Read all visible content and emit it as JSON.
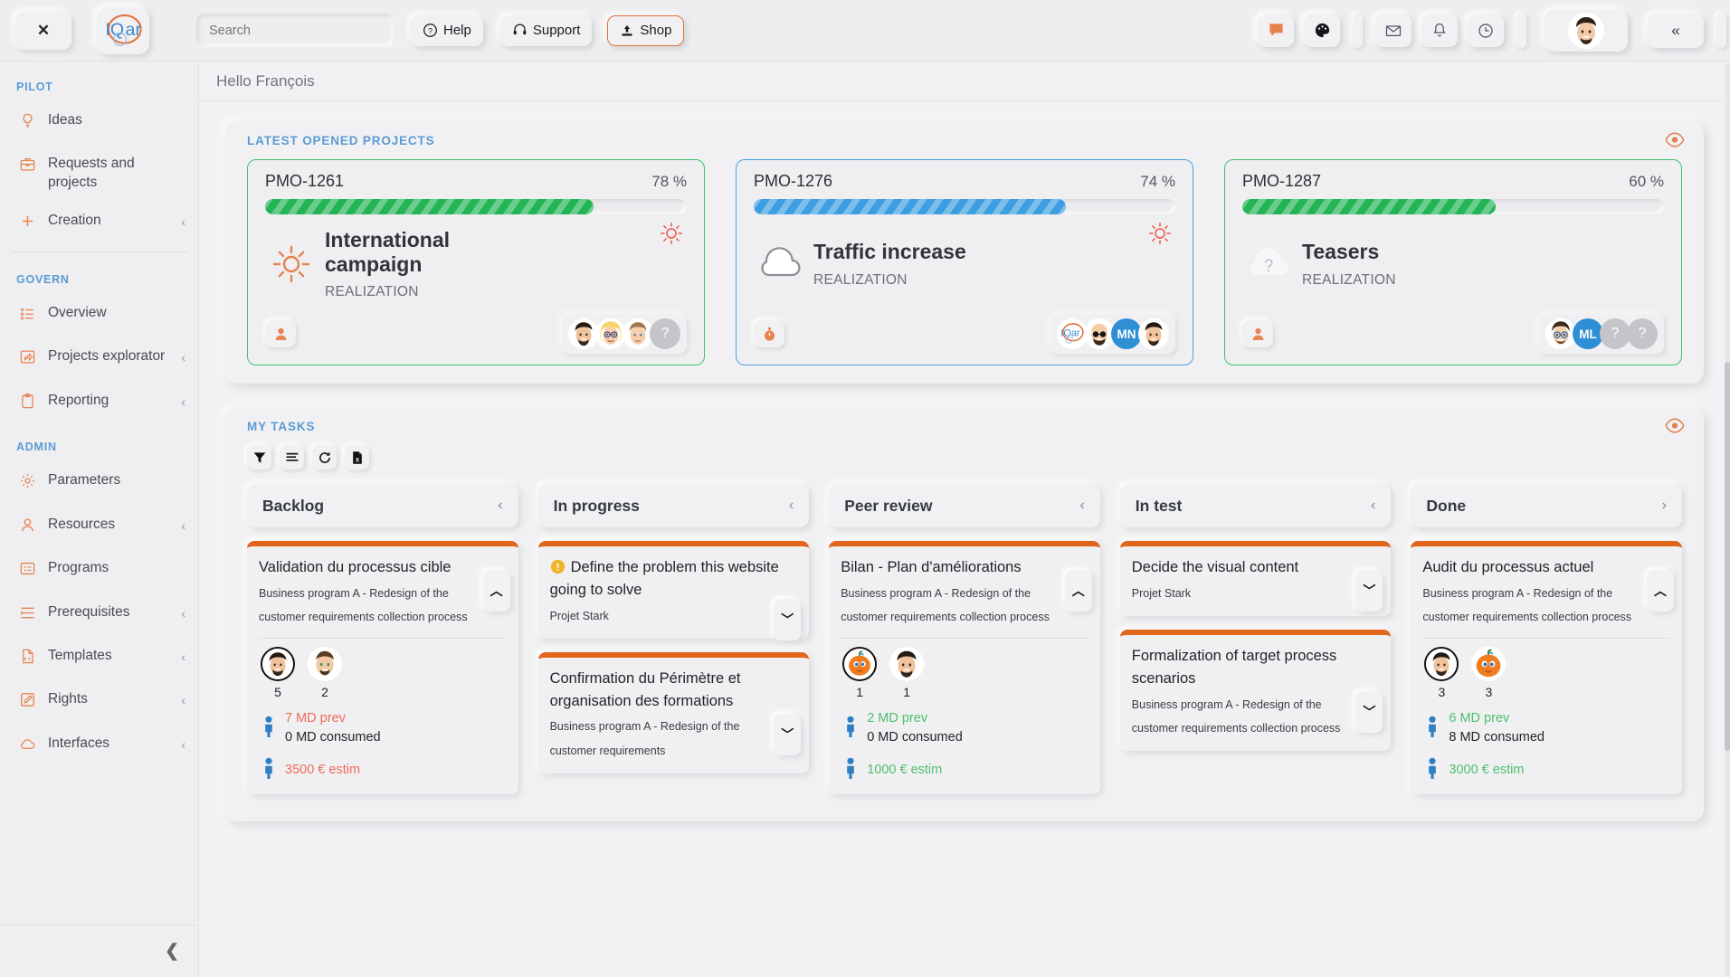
{
  "topbar": {
    "close_label": "✕",
    "logo_text": "IQar",
    "search": {
      "placeholder": "Search",
      "value": ""
    },
    "help_label": "Help",
    "support_label": "Support",
    "shop_label": "Shop",
    "icons": [
      {
        "name": "feedback-icon",
        "glyph": "▰"
      },
      {
        "name": "theme-palette-icon",
        "glyph": "◕"
      },
      {
        "name": "mail-icon",
        "glyph": "✉"
      },
      {
        "name": "bell-icon",
        "glyph": "🔔"
      },
      {
        "name": "clock-icon",
        "glyph": "◷"
      }
    ],
    "collapse_label": "«",
    "accent": "#e2703a"
  },
  "sidebar": {
    "groups": [
      {
        "title": "PILOT",
        "items": [
          {
            "label": "Ideas",
            "icon": "bulb-icon",
            "chevron": ""
          },
          {
            "label": "Requests and projects",
            "icon": "briefcase-icon",
            "chevron": ""
          },
          {
            "label": "Creation",
            "icon": "plus-icon",
            "chevron": "‹"
          }
        ]
      },
      {
        "title": "GOVERN",
        "items": [
          {
            "label": "Overview",
            "icon": "list-icon",
            "chevron": ""
          },
          {
            "label": "Projects explorator",
            "icon": "share-box-icon",
            "chevron": "‹"
          },
          {
            "label": "Reporting",
            "icon": "clipboard-icon",
            "chevron": "‹"
          }
        ]
      },
      {
        "title": "ADMIN",
        "items": [
          {
            "label": "Parameters",
            "icon": "gear-icon",
            "chevron": ""
          },
          {
            "label": "Resources",
            "icon": "user-icon",
            "chevron": "‹"
          },
          {
            "label": "Programs",
            "icon": "grid-card-icon",
            "chevron": ""
          },
          {
            "label": "Prerequisites",
            "icon": "indent-list-icon",
            "chevron": "‹"
          },
          {
            "label": "Templates",
            "icon": "file-code-icon",
            "chevron": "‹"
          },
          {
            "label": "Rights",
            "icon": "edit-square-icon",
            "chevron": "‹"
          },
          {
            "label": "Interfaces",
            "icon": "cloud-icon",
            "chevron": "‹"
          }
        ]
      }
    ],
    "collapse_label": "❮"
  },
  "main": {
    "greeting": "Hello François",
    "projects_panel": {
      "title": "LATEST OPENED PROJECTS",
      "eye_icon": "eye-icon",
      "cards": [
        {
          "code": "PMO-1261",
          "percent": "78 %",
          "progress": 78,
          "bar_color": "green",
          "border": "green",
          "name": "International campaign",
          "phase": "REALIZATION",
          "weather_icon": "sun-icon",
          "alert_icon": "sun-alert-icon",
          "role_icon": "user-role-icon",
          "avatars": [
            {
              "type": "photo",
              "face": "man-beard",
              "label": ""
            },
            {
              "type": "photo",
              "face": "woman-glasses",
              "label": ""
            },
            {
              "type": "photo",
              "face": "man-young",
              "label": ""
            },
            {
              "type": "unknown",
              "label": "?"
            }
          ]
        },
        {
          "code": "PMO-1276",
          "percent": "74 %",
          "progress": 74,
          "bar_color": "blue",
          "border": "blue",
          "name": "Traffic increase",
          "phase": "REALIZATION",
          "weather_icon": "cloud-icon",
          "alert_icon": "sun-alert-icon",
          "role_icon": "stopwatch-role-icon",
          "avatars": [
            {
              "type": "logo",
              "label": "IQar"
            },
            {
              "type": "photo",
              "face": "man-bald-glasses",
              "label": ""
            },
            {
              "type": "initials",
              "label": "MN"
            },
            {
              "type": "photo",
              "face": "man-beard",
              "label": ""
            }
          ]
        },
        {
          "code": "PMO-1287",
          "percent": "60 %",
          "progress": 60,
          "bar_color": "green",
          "border": "green",
          "name": "Teasers",
          "phase": "REALIZATION",
          "weather_icon": "cloud-question-icon",
          "alert_icon": "",
          "role_icon": "user-role-icon",
          "avatars": [
            {
              "type": "photo",
              "face": "man-glasses-smile",
              "label": ""
            },
            {
              "type": "initials",
              "label": "ML"
            },
            {
              "type": "unknown",
              "label": "?"
            },
            {
              "type": "unknown",
              "label": "?"
            }
          ]
        }
      ]
    },
    "tasks_panel": {
      "title": "MY TASKS",
      "eye_icon": "eye-icon",
      "tools": [
        {
          "name": "filter-icon",
          "glyph": "▼"
        },
        {
          "name": "list-lines-icon",
          "glyph": "≡"
        },
        {
          "name": "refresh-icon",
          "glyph": "⟳"
        },
        {
          "name": "excel-export-icon",
          "glyph": "X"
        }
      ],
      "columns": [
        {
          "label": "Backlog",
          "chevron": "‹",
          "cards": [
            {
              "title": "Validation du processus cible",
              "warn": false,
              "subtitle": "Business program A - Redesign of the customer requirements collection process",
              "toggle": "^",
              "expanded": true,
              "avatars": [
                {
                  "face": "man-beard",
                  "count": "5",
                  "ring": true
                },
                {
                  "face": "man-smile",
                  "count": "2",
                  "ring": false
                }
              ],
              "metrics": [
                {
                  "icon": "person-icon",
                  "line1": "7 MD prev",
                  "line1_color": "red",
                  "line2": "0 MD consumed"
                },
                {
                  "icon": "person-icon",
                  "line1": "3500 € estim",
                  "line1_color": "red",
                  "line2": ""
                }
              ]
            }
          ]
        },
        {
          "label": "In progress",
          "chevron": "‹",
          "cards": [
            {
              "title": "Define the problem this website going to solve",
              "warn": true,
              "subtitle": "Projet Stark",
              "toggle": "⌄",
              "expanded": false,
              "avatars": [],
              "metrics": []
            },
            {
              "title": "Confirmation du Périmètre et organisation des formations",
              "warn": false,
              "subtitle": "Business program A - Redesign of the customer requirements",
              "toggle": "⌄",
              "expanded": false,
              "avatars": [],
              "metrics": []
            }
          ]
        },
        {
          "label": "Peer review",
          "chevron": "‹",
          "cards": [
            {
              "title": "Bilan - Plan d'améliorations",
              "warn": false,
              "subtitle": "Business program A - Redesign of the customer requirements collection process",
              "toggle": "^",
              "expanded": true,
              "avatars": [
                {
                  "face": "pumpkin",
                  "count": "1",
                  "ring": true
                },
                {
                  "face": "man-beard",
                  "count": "1",
                  "ring": false
                }
              ],
              "metrics": [
                {
                  "icon": "person-icon",
                  "line1": "2 MD prev",
                  "line1_color": "green",
                  "line2": "0 MD consumed"
                },
                {
                  "icon": "person-icon",
                  "line1": "1000 € estim",
                  "line1_color": "green",
                  "line2": ""
                }
              ]
            }
          ]
        },
        {
          "label": "In test",
          "chevron": "‹",
          "cards": [
            {
              "title": "Decide the visual content",
              "warn": false,
              "subtitle": "Projet Stark",
              "toggle": "⌄",
              "expanded": false,
              "avatars": [],
              "metrics": []
            },
            {
              "title": "Formalization of target process scenarios",
              "warn": false,
              "subtitle": "Business program A - Redesign of the customer requirements collection process",
              "toggle": "⌄",
              "expanded": false,
              "avatars": [],
              "metrics": []
            }
          ]
        },
        {
          "label": "Done",
          "chevron": "›",
          "cards": [
            {
              "title": "Audit du processus actuel",
              "warn": false,
              "subtitle": "Business program A - Redesign of the customer requirements collection process",
              "toggle": "^",
              "expanded": true,
              "avatars": [
                {
                  "face": "man-beard",
                  "count": "3",
                  "ring": true
                },
                {
                  "face": "pumpkin",
                  "count": "3",
                  "ring": false
                }
              ],
              "metrics": [
                {
                  "icon": "person-icon",
                  "line1": "6 MD prev",
                  "line1_color": "green",
                  "line2": "8 MD consumed",
                  "line2_color": "red"
                },
                {
                  "icon": "person-icon",
                  "line1": "3000 € estim",
                  "line1_color": "green",
                  "line2": ""
                }
              ]
            }
          ]
        }
      ]
    }
  },
  "colors": {
    "accent_orange": "#e2703a",
    "card_top_orange": "#e2651c",
    "blue_label": "#5b9bd5",
    "green": "#23b455",
    "blue": "#3c9ee0"
  }
}
